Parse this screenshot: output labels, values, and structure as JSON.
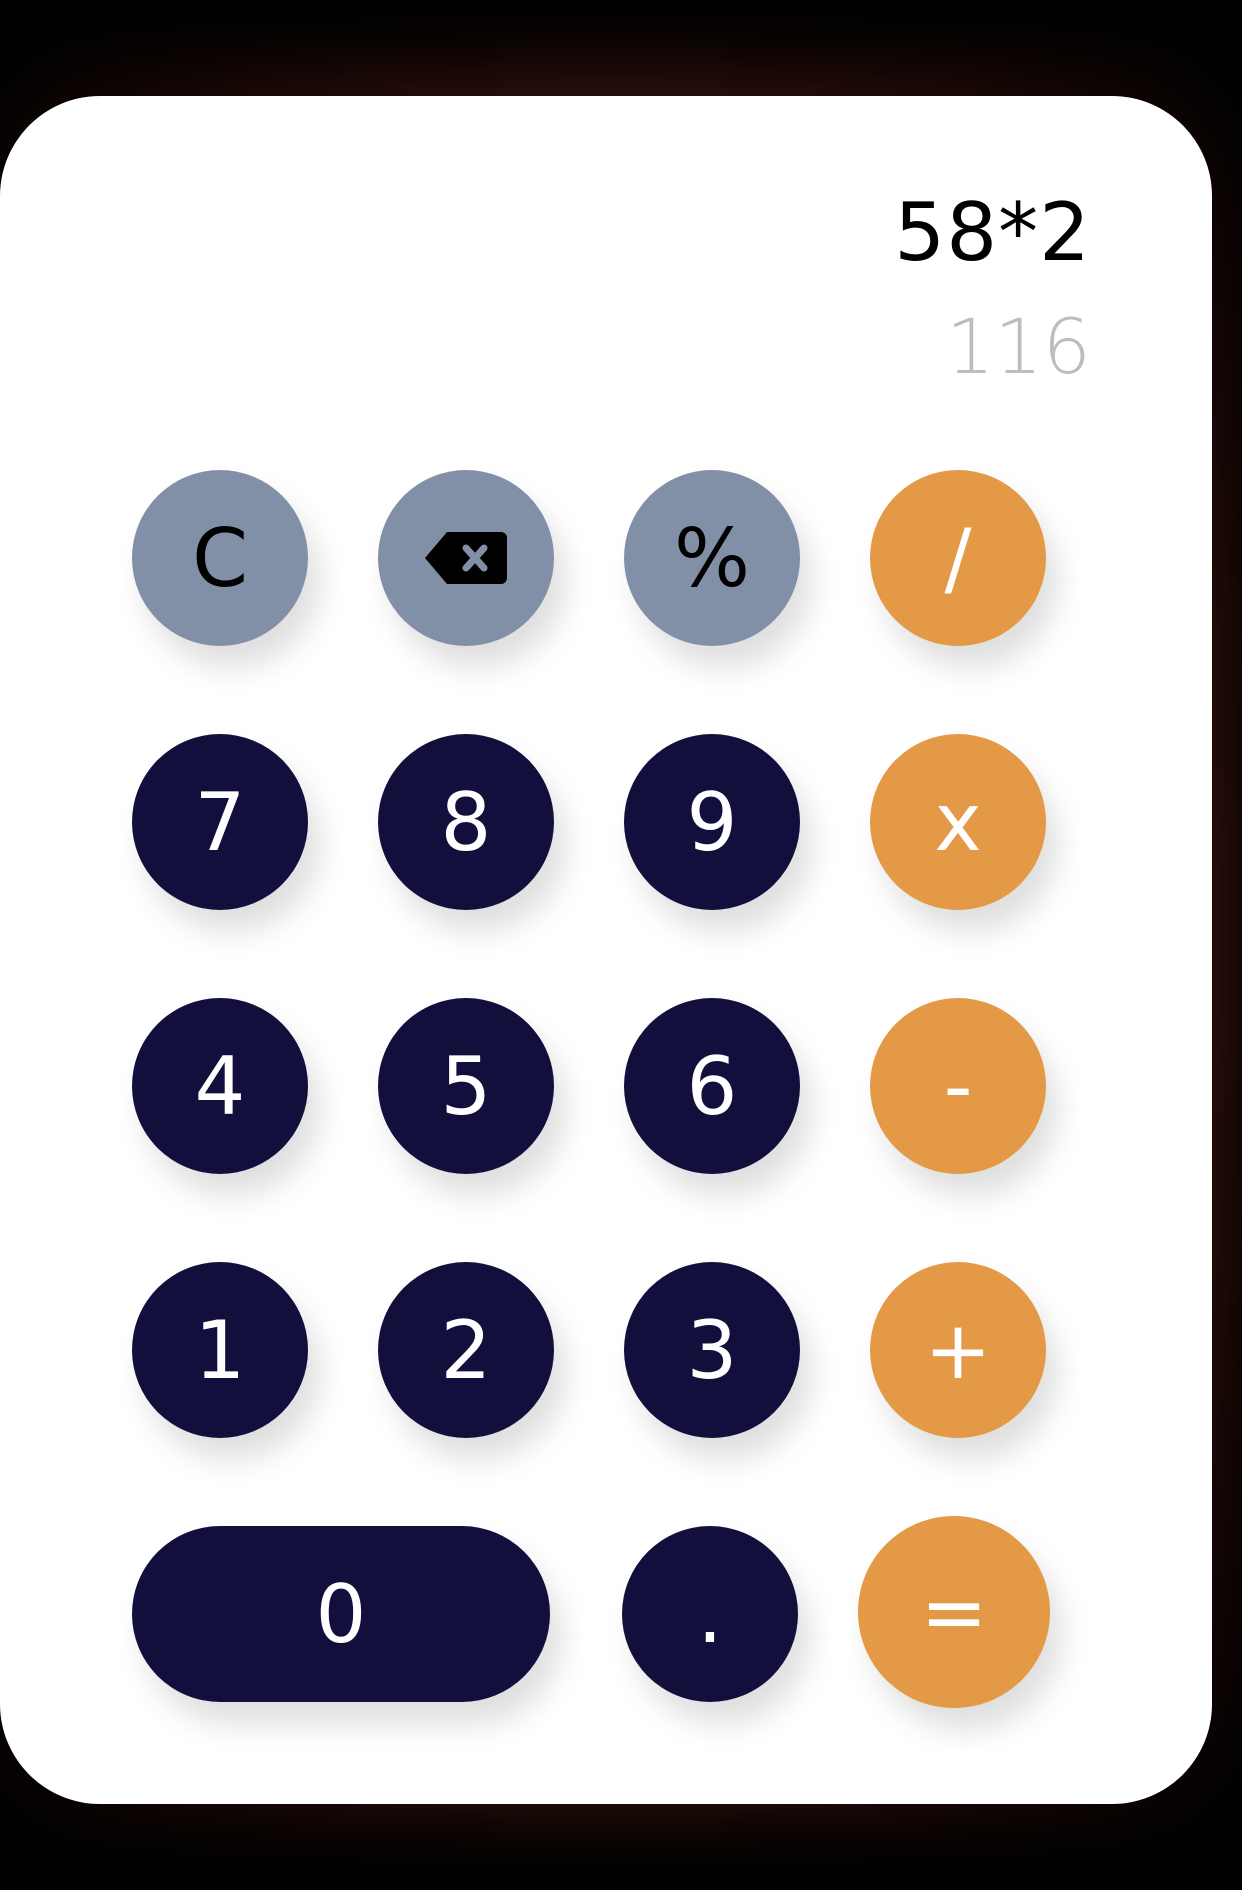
{
  "display": {
    "expression": "58*2",
    "result": "116"
  },
  "keys": {
    "clear": "C",
    "backspace_icon": "backspace-icon",
    "percent": "%",
    "divide": "/",
    "seven": "7",
    "eight": "8",
    "nine": "9",
    "multiply": "x",
    "four": "4",
    "five": "5",
    "six": "6",
    "subtract": "-",
    "one": "1",
    "two": "2",
    "three": "3",
    "add": "+",
    "zero": "0",
    "decimal": ".",
    "equals": "="
  },
  "colors": {
    "function_key": "#8290a7",
    "digit_key": "#130f3d",
    "operator_key": "#e39946",
    "result_text": "#bdbdbd"
  }
}
